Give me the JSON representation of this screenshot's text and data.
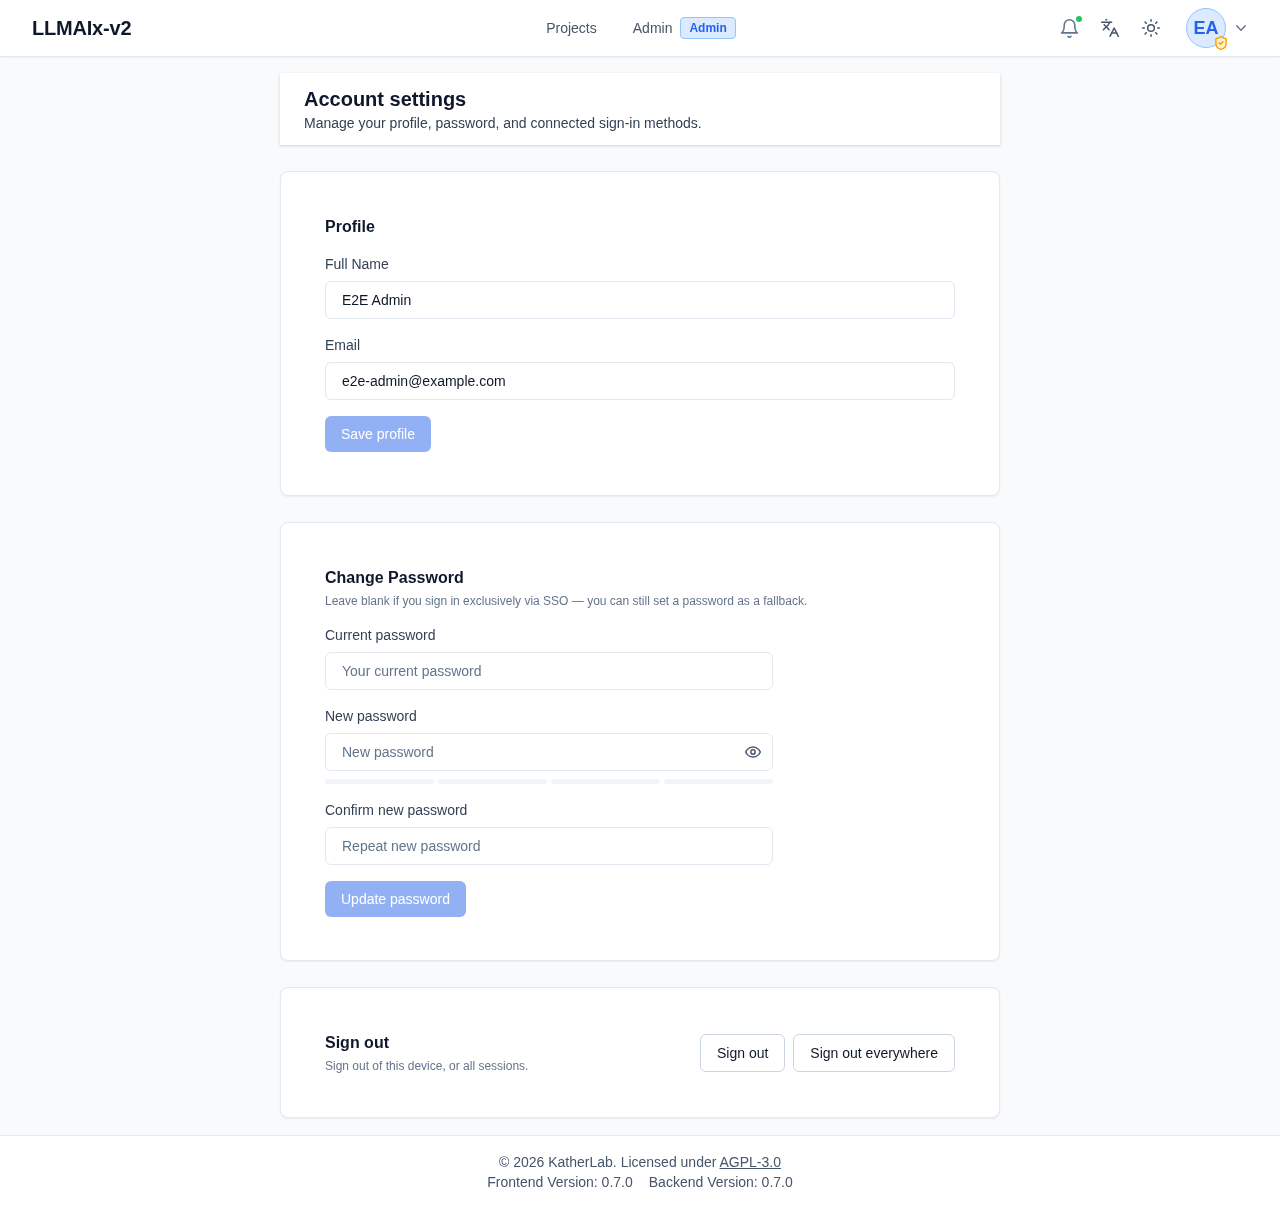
{
  "header": {
    "logo": "LLMAIx-v2",
    "nav": [
      {
        "label": "Projects",
        "selected": false
      },
      {
        "label": "Admin",
        "selected": false,
        "badge": "Admin"
      }
    ],
    "notifications": {
      "unread": true
    },
    "account": {
      "initials": "EA",
      "admin": true
    }
  },
  "page_header": {
    "title": "Account settings",
    "subtitle": "Manage your profile, password, and connected sign-in methods."
  },
  "profile": {
    "title": "Profile",
    "fields": [
      {
        "label": "Full Name",
        "value": "E2E Admin"
      },
      {
        "label": "Email",
        "value": "e2e-admin@example.com"
      }
    ],
    "button": {
      "label": "Save profile",
      "disabled": true
    }
  },
  "password": {
    "title": "Change Password",
    "description": "Leave blank if you sign in exclusively via SSO — you can still set a password as a fallback.",
    "fields": [
      {
        "label": "Current password",
        "placeholder": "Your current password",
        "kind": "plain"
      },
      {
        "label": "New password",
        "placeholder": "New password",
        "kind": "revealable",
        "strength_meter": {
          "segments": [
            {
              "filled": false
            },
            {
              "filled": false
            },
            {
              "filled": false
            },
            {
              "filled": false
            }
          ]
        }
      },
      {
        "label": "Confirm new password",
        "placeholder": "Repeat new password",
        "kind": "plain"
      }
    ],
    "button": {
      "label": "Update password",
      "disabled": true
    }
  },
  "sign_out": {
    "title": "Sign out",
    "description": "Sign out of this device, or all sessions.",
    "buttons": [
      "Sign out",
      "Sign out everywhere"
    ]
  },
  "footer": {
    "copyright": "© 2026 KatherLab. Licensed under",
    "license_link": "AGPL-3.0",
    "versions": [
      "Frontend Version: 0.7.0",
      "Backend Version: 0.7.0"
    ]
  }
}
